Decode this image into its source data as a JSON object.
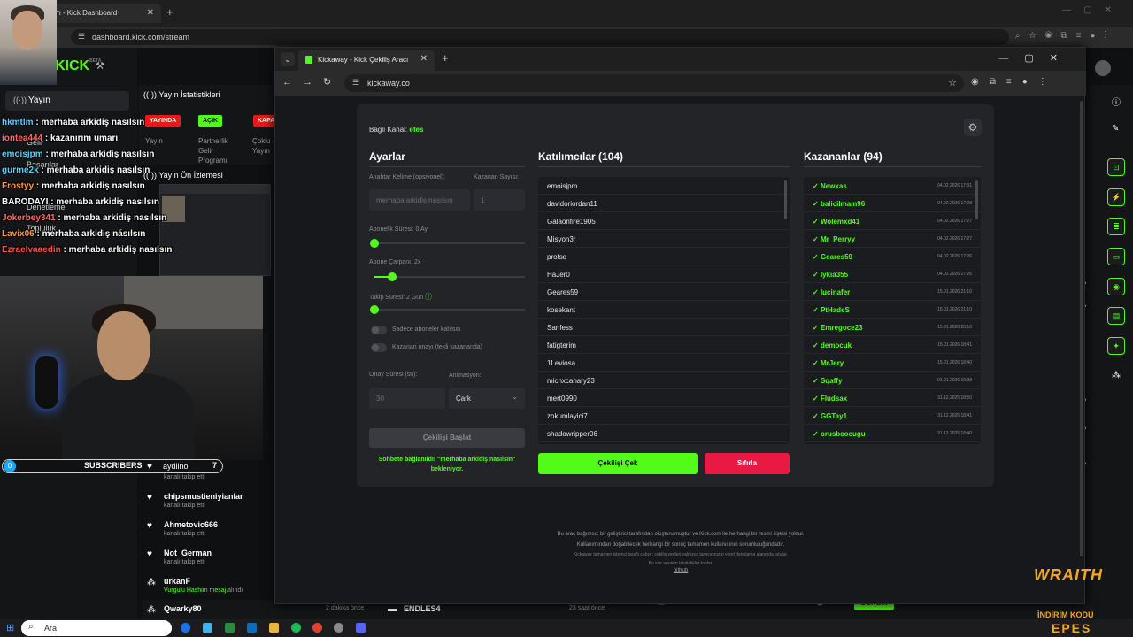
{
  "back_browser": {
    "tab_title": "m - Kick Dashboard",
    "url": "dashboard.kick.com/stream"
  },
  "kick": {
    "logo": "KICK",
    "logo_badge": "BETA",
    "sidebar": {
      "active": "Yayın",
      "items": [
        "Gelir",
        "Başarılar",
        "Denetleme",
        "Topluluk"
      ]
    },
    "stats": {
      "title": "Yayın İstatistikleri",
      "badges": [
        "YAYINDA",
        "AÇIK",
        "KAPA"
      ],
      "labels": [
        "Yayın",
        "Partnerlik\nGelir\nProgramı",
        "Çoklu\nYayın"
      ]
    },
    "preview_title": "Yayın Ön İzlemesi",
    "chat": [
      {
        "user": "hkmtlm",
        "msg": "merhaba arkidiş nasılsın",
        "color": "#5ad1ff"
      },
      {
        "user": "iontea444",
        "msg": "kazanırım umarı",
        "color": "#ff6b6b"
      },
      {
        "user": "emoisjpm",
        "msg": "merhaba arkidiş nasılsın",
        "color": "#5ad1ff"
      },
      {
        "user": "gurme2k",
        "msg": "merhaba arkidiş nasılsın",
        "color": "#5ad1ff"
      },
      {
        "user": "Frostyy",
        "msg": "merhaba arkidiş nasılsın",
        "color": "#ff9b3d"
      },
      {
        "user": "BARODAYI",
        "msg": "merhaba arkidiş nasılsın",
        "color": "#ffffff"
      },
      {
        "user": "Jokerbey341",
        "msg": "merhaba arkidiş nasılsın",
        "color": "#ff6b6b"
      },
      {
        "user": "Lavix06",
        "msg": "merhaba arkidiş nasılsın",
        "color": "#ff9b3d"
      },
      {
        "user": "Ezraelvaaedin",
        "msg": "merhaba arkidiş nasılsın",
        "color": "#ff4d4d"
      }
    ],
    "subscribers": {
      "count_left": "0",
      "label": "SUBSCRIBERS",
      "name": "aydiino",
      "count": "7"
    },
    "feed": [
      {
        "name": "chipsmustieniyianlar",
        "sub": "kanalı takip etti"
      },
      {
        "name": "Ahmetovic666",
        "sub": "kanalı takip etti"
      },
      {
        "name": "Not_German",
        "sub": "kanalı takip etti"
      },
      {
        "name": "urkanF",
        "sub": "Vurgulu Hashim mesaj",
        "sub2": "alındı"
      }
    ],
    "feed_top": {
      "sub": "kanalı takip etti"
    },
    "bottom": {
      "left_name": "Qwarky80",
      "left_time": "2 dakika önce",
      "mid_name": "ENDLES4",
      "mid_time": "23 saat önce",
      "counter": "0",
      "send": "Gönder"
    }
  },
  "taskbar": {
    "search": "Ara"
  },
  "ad": {
    "brand": "WRAITH",
    "line1": "İNDİRİM KODU",
    "line2": "EPES"
  },
  "front_browser": {
    "tab_title": "Kickaway - Kick Çekiliş Aracı",
    "url": "kickaway.co"
  },
  "kickaway": {
    "connected_label": "Bağlı Kanal:",
    "connected_channel": "efes",
    "settings": {
      "title": "Ayarlar",
      "keyword_label": "Anahtar Kelime (opsiyonel):",
      "keyword_value": "merhaba arkidiş nasılsın",
      "winners_label": "Kazanan Sayısı:",
      "winners_value": "1",
      "sub_duration_label": "Abonelik Süresi: 0 Ay",
      "sub_duration_level": 0,
      "sub_multiplier_label": "Abone Çarpanı: 2x",
      "sub_multiplier_level": 0.12,
      "follow_duration_label": "Takip Süresi: 2 Gün",
      "follow_duration_level": 0,
      "toggle_subs_only": "Sadece aboneler katılsın",
      "toggle_winner_confirm": "Kazanan onayı (tekli kazananda)",
      "confirm_time_label": "Onay Süresi (sn):",
      "confirm_time_value": "30",
      "animation_label": "Animasyon:",
      "animation_value": "Çark",
      "start_button": "Çekilişi Başlat",
      "waiting_message": "Sohbete bağlanıldı! \"merhaba arkidiş nasılsın\" bekleniyor."
    },
    "participants": {
      "title": "Katılımcılar (104)",
      "items": [
        "emoisjpm",
        "davidoriordan11",
        "Galaonfire1905",
        "Misyon3r",
        "profsq",
        "HaJer0",
        "Geares59",
        "kosekant",
        "Sanfess",
        "fatigterim",
        "1Leviosa",
        "michxcanary23",
        "mert0990",
        "zokumlayici7",
        "shadowripper06"
      ]
    },
    "winners": {
      "title": "Kazananlar (94)",
      "items": [
        {
          "name": "Newxas",
          "date": "04.02.2026 17:31"
        },
        {
          "name": "balicilmam96",
          "date": "04.02.2026 17:28"
        },
        {
          "name": "Wolemxd41",
          "date": "04.02.2026 17:27"
        },
        {
          "name": "Mr_Perryy",
          "date": "04.02.2026 17:27"
        },
        {
          "name": "Geares59",
          "date": "04.02.2026 17:26"
        },
        {
          "name": "lykia355",
          "date": "04.02.2026 17:26"
        },
        {
          "name": "lucinafer",
          "date": "15.01.2026 21:10"
        },
        {
          "name": "PtHadeS",
          "date": "15.01.2026 21:10"
        },
        {
          "name": "Emregoce23",
          "date": "15.01.2026 20:10"
        },
        {
          "name": "democuk",
          "date": "15.01.2026 18:41"
        },
        {
          "name": "MrJery",
          "date": "15.01.2026 18:40"
        },
        {
          "name": "Sqaffy",
          "date": "01.01.2026 19:38"
        },
        {
          "name": "Fludsax",
          "date": "31.12.2025 18:50"
        },
        {
          "name": "GGTay1",
          "date": "31.12.2025 18:41"
        },
        {
          "name": "orusbcocugu",
          "date": "31.12.2025 18:40"
        }
      ]
    },
    "draw_button": "Çekilişi Çek",
    "reset_button": "Sıfırla",
    "footer": {
      "line1": "Bu araç bağımsız bir geliştirici tarafından oluşturulmuştur ve Kick.com ile herhangi bir resmi ilişkisi yoktur.",
      "line2": "Kullanımından doğabilecek herhangi bir sonuç tamamen kullanıcının sorumluluğundadır.",
      "line3": "Kickaway tamamen istemci taraflı çalışır; çekiliş verileri yalnızca tarayıcınızın yerel depolama alanında tutulur.",
      "line4": "Bu site anonim istatistikler toplar.",
      "link": "github"
    }
  }
}
